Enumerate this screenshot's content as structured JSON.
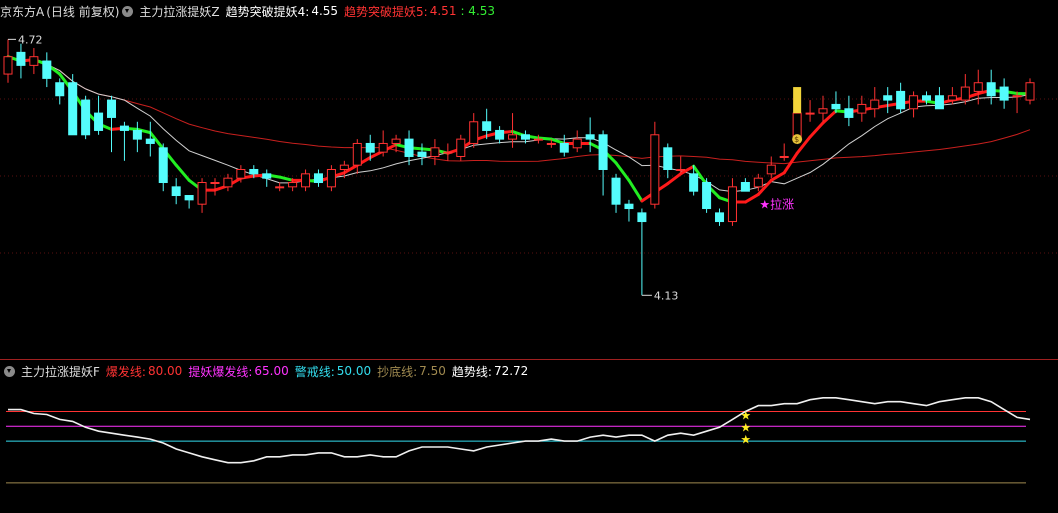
{
  "header": {
    "stock": "京东方A",
    "period": "(日线 前复权)",
    "indicator": "主力拉涨提妖Z",
    "item1_label": "趋势突破提妖4:",
    "item1_value": "4.55",
    "item2_label": "趋势突破提妖5:",
    "item2_value": "4.51",
    "item2_value2": ": 4.53"
  },
  "sub_header": {
    "indicator": "主力拉涨提妖F",
    "lines": [
      {
        "label": "爆发线:",
        "value": "80.00",
        "color": "#ff3333"
      },
      {
        "label": "提妖爆发线:",
        "value": "65.00",
        "color": "#ff33ff"
      },
      {
        "label": "警戒线:",
        "value": "50.00",
        "color": "#33ddee"
      },
      {
        "label": "抄底线:",
        "value": "7.50",
        "color": "#a08a50"
      },
      {
        "label": "趋势线:",
        "value": "72.72",
        "color": "#ffffff"
      }
    ]
  },
  "annotations": {
    "high_label": "4.72",
    "low_label": "4.13",
    "signal_label": "★拉涨",
    "forecast_badge": "预",
    "money_icon": "money-bag-icon"
  },
  "colors": {
    "up": "#ff3232",
    "down": "#54fcfc",
    "trend_up": "#ff1a1a",
    "trend_down": "#22ee22",
    "ma_white": "#d0d0d0",
    "ma_red": "#c8201e"
  },
  "chart_data": [
    {
      "type": "candlestick",
      "title": "",
      "ylim": [
        4.05,
        4.76
      ],
      "candles": [
        [
          4.64,
          4.68,
          4.72,
          4.62
        ],
        [
          4.69,
          4.66,
          4.71,
          4.63
        ],
        [
          4.66,
          4.68,
          4.7,
          4.64
        ],
        [
          4.67,
          4.63,
          4.69,
          4.61
        ],
        [
          4.62,
          4.59,
          4.63,
          4.57
        ],
        [
          4.62,
          4.5,
          4.64,
          4.5
        ],
        [
          4.58,
          4.5,
          4.59,
          4.49
        ],
        [
          4.55,
          4.51,
          4.59,
          4.5
        ],
        [
          4.58,
          4.54,
          4.59,
          4.46
        ],
        [
          4.52,
          4.51,
          4.53,
          4.44
        ],
        [
          4.51,
          4.49,
          4.53,
          4.46
        ],
        [
          4.49,
          4.48,
          4.53,
          4.45
        ],
        [
          4.47,
          4.39,
          4.48,
          4.37
        ],
        [
          4.38,
          4.36,
          4.4,
          4.34
        ],
        [
          4.36,
          4.35,
          4.36,
          4.33
        ],
        [
          4.34,
          4.39,
          4.4,
          4.32
        ],
        [
          4.39,
          4.39,
          4.4,
          4.36
        ],
        [
          4.38,
          4.4,
          4.41,
          4.37
        ],
        [
          4.4,
          4.42,
          4.43,
          4.39
        ],
        [
          4.42,
          4.41,
          4.43,
          4.4
        ],
        [
          4.41,
          4.4,
          4.42,
          4.38
        ],
        [
          4.38,
          4.38,
          4.39,
          4.37
        ],
        [
          4.38,
          4.39,
          4.4,
          4.37
        ],
        [
          4.38,
          4.41,
          4.42,
          4.37
        ],
        [
          4.41,
          4.39,
          4.42,
          4.38
        ],
        [
          4.38,
          4.42,
          4.43,
          4.37
        ],
        [
          4.42,
          4.43,
          4.44,
          4.4
        ],
        [
          4.43,
          4.48,
          4.49,
          4.41
        ],
        [
          4.48,
          4.46,
          4.5,
          4.44
        ],
        [
          4.46,
          4.48,
          4.51,
          4.45
        ],
        [
          4.48,
          4.49,
          4.5,
          4.46
        ],
        [
          4.49,
          4.45,
          4.51,
          4.43
        ],
        [
          4.46,
          4.45,
          4.48,
          4.43
        ],
        [
          4.45,
          4.47,
          4.49,
          4.43
        ],
        [
          4.46,
          4.46,
          4.48,
          4.44
        ],
        [
          4.45,
          4.49,
          4.5,
          4.44
        ],
        [
          4.48,
          4.53,
          4.55,
          4.47
        ],
        [
          4.53,
          4.51,
          4.56,
          4.49
        ],
        [
          4.51,
          4.49,
          4.52,
          4.48
        ],
        [
          4.49,
          4.5,
          4.55,
          4.47
        ],
        [
          4.5,
          4.49,
          4.51,
          4.48
        ],
        [
          4.49,
          4.49,
          4.5,
          4.48
        ],
        [
          4.48,
          4.48,
          4.49,
          4.47
        ],
        [
          4.48,
          4.46,
          4.5,
          4.45
        ],
        [
          4.47,
          4.49,
          4.51,
          4.46
        ],
        [
          4.5,
          4.49,
          4.54,
          4.46
        ],
        [
          4.5,
          4.42,
          4.51,
          4.36
        ],
        [
          4.4,
          4.34,
          4.41,
          4.32
        ],
        [
          4.34,
          4.33,
          4.35,
          4.3
        ],
        [
          4.32,
          4.3,
          4.33,
          4.13
        ],
        [
          4.34,
          4.5,
          4.53,
          4.33
        ],
        [
          4.47,
          4.42,
          4.48,
          4.4
        ],
        [
          4.42,
          4.42,
          4.45,
          4.41
        ],
        [
          4.41,
          4.37,
          4.43,
          4.36
        ],
        [
          4.39,
          4.33,
          4.4,
          4.32
        ],
        [
          4.32,
          4.3,
          4.33,
          4.29
        ],
        [
          4.3,
          4.38,
          4.4,
          4.29
        ],
        [
          4.39,
          4.37,
          4.4,
          4.37
        ],
        [
          4.38,
          4.4,
          4.41,
          4.37
        ],
        [
          4.41,
          4.43,
          4.45,
          4.4
        ],
        [
          4.45,
          4.45,
          4.48,
          4.44
        ],
        [
          4.49,
          4.55,
          4.57,
          4.48
        ],
        [
          4.55,
          4.55,
          4.58,
          4.53
        ],
        [
          4.55,
          4.56,
          4.59,
          4.53
        ],
        [
          4.57,
          4.56,
          4.6,
          4.55
        ],
        [
          4.56,
          4.54,
          4.59,
          4.52
        ],
        [
          4.55,
          4.57,
          4.59,
          4.53
        ],
        [
          4.56,
          4.58,
          4.61,
          4.54
        ],
        [
          4.59,
          4.58,
          4.61,
          4.55
        ],
        [
          4.6,
          4.56,
          4.62,
          4.55
        ],
        [
          4.56,
          4.59,
          4.6,
          4.54
        ],
        [
          4.59,
          4.58,
          4.6,
          4.57
        ],
        [
          4.59,
          4.56,
          4.61,
          4.56
        ],
        [
          4.58,
          4.59,
          4.61,
          4.57
        ],
        [
          4.58,
          4.61,
          4.64,
          4.57
        ],
        [
          4.6,
          4.62,
          4.65,
          4.57
        ],
        [
          4.62,
          4.59,
          4.65,
          4.57
        ],
        [
          4.61,
          4.58,
          4.63,
          4.56
        ],
        [
          4.59,
          4.59,
          4.6,
          4.55
        ],
        [
          4.58,
          4.62,
          4.63,
          4.57
        ]
      ]
    },
    {
      "type": "line",
      "title": "",
      "ylim": [
        -20,
        110
      ],
      "hlines": [
        80,
        65,
        50,
        7.5
      ],
      "series": [
        {
          "values": [
            82,
            82,
            78,
            77,
            72,
            70,
            64,
            60,
            58,
            56,
            54,
            52,
            48,
            42,
            38,
            34,
            31,
            28,
            28,
            30,
            34,
            34,
            36,
            36,
            38,
            38,
            34,
            34,
            36,
            34,
            34,
            40,
            44,
            44,
            44,
            42,
            40,
            44,
            46,
            48,
            50,
            50,
            52,
            50,
            50,
            54,
            56,
            54,
            56,
            56,
            50,
            56,
            58,
            56,
            60,
            64,
            72,
            80,
            86,
            86,
            88,
            88,
            92,
            94,
            94,
            92,
            90,
            88,
            90,
            90,
            88,
            86,
            90,
            92,
            94,
            94,
            90,
            82,
            74,
            72
          ]
        }
      ]
    }
  ]
}
